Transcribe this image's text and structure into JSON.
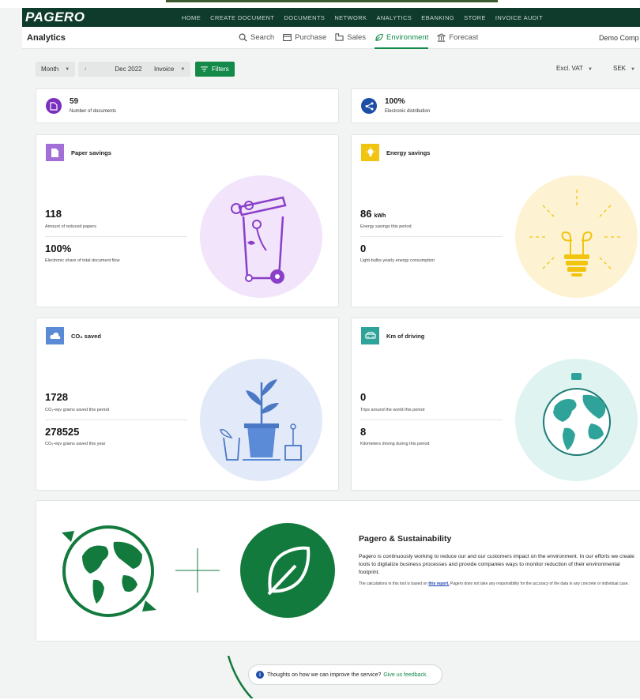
{
  "brand": {
    "logo_text": "PAGERO",
    "nav_bg": "#0e3b2c",
    "accent": "#13894a"
  },
  "top_nav": [
    "HOME",
    "CREATE DOCUMENT",
    "DOCUMENTS",
    "NETWORK",
    "ANALYTICS",
    "EBANKING",
    "STORE",
    "INVOICE AUDIT"
  ],
  "sub_nav": {
    "title": "Analytics",
    "tabs": [
      {
        "label": "Search",
        "icon": "search-icon"
      },
      {
        "label": "Purchase",
        "icon": "purchase-icon"
      },
      {
        "label": "Sales",
        "icon": "sales-icon"
      },
      {
        "label": "Environment",
        "icon": "leaf-icon",
        "active": true
      },
      {
        "label": "Forecast",
        "icon": "bank-icon"
      }
    ],
    "company": "Demo Comp"
  },
  "filters": {
    "period_type": "Month",
    "period": "Dec 2022",
    "doc_type": "Invoice",
    "filters_label": "Filters",
    "vat": "Excl. VAT",
    "currency": "SEK"
  },
  "kpis": {
    "documents": {
      "value": "59",
      "label": "Number of documents",
      "color": "#7b2fbf"
    },
    "distribution": {
      "value": "100%",
      "label": "Electronic distribution",
      "color": "#1d4ea8"
    }
  },
  "cards": {
    "paper": {
      "title": "Paper savings",
      "v1": "118",
      "l1": "Amount of reduced papers",
      "v2": "100%",
      "l2": "Electronic share of total document flow",
      "color": "#a26fd6",
      "bg": "#f1e4fb"
    },
    "energy": {
      "title": "Energy savings",
      "v1": "86",
      "v1_unit": "kWh",
      "l1": "Energy savings this period",
      "v2": "0",
      "l2": "Light-bulbs yearly energy consumption",
      "color": "#f1c40f",
      "bg": "#fdf3d3"
    },
    "co2": {
      "title": "CO₂ saved",
      "v1": "1728",
      "l1": "CO₂-eqv grams saved this period",
      "v2": "278525",
      "l2": "CO₂-eqv grams saved this year",
      "color": "#5b8ad6",
      "bg": "#e2e9f9"
    },
    "driving": {
      "title": "Km of driving",
      "v1": "0",
      "l1": "Trips around the world this period",
      "v2": "8",
      "l2": "Kilometers driving during this period",
      "color": "#2fa39a",
      "bg": "#dff3f1"
    }
  },
  "sustainability": {
    "title": "Pagero & Sustainability",
    "body": "Pagero is continuously working to reduce our and our customers impact on the environment. In our efforts we create tools to digitalize business processes and provide companies ways to monitor reduction of their environmental footprint.",
    "note_before": "The calculations in this tool is based on ",
    "note_link": "this report.",
    "note_after": " Pagero does not take any responsibility for the accuracy of the data in any concrete or individual case."
  },
  "feedback": {
    "text": "Thoughts on how we can improve the service?",
    "link": "Give us feedback."
  }
}
